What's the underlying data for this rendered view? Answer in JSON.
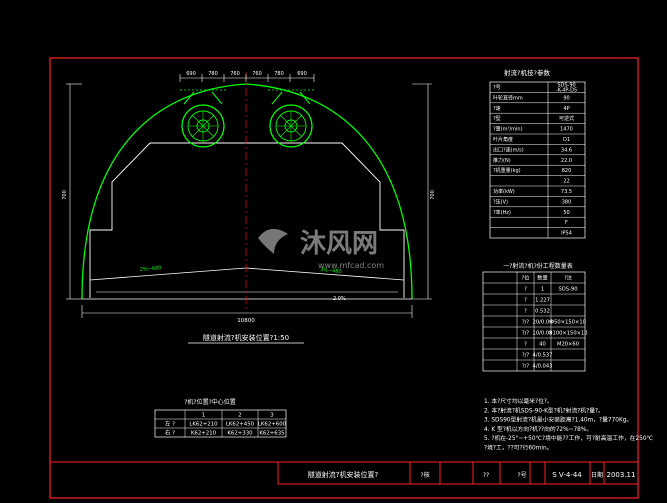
{
  "colors": {
    "frame": "#ff2020",
    "lining": "#00ff00",
    "dims": "#ffffff",
    "text": "#ffffff",
    "fan": "#00ff00",
    "center": "#ff0000",
    "table": "#ffffff"
  },
  "drawing": {
    "top_dims": [
      "690",
      "780",
      "760",
      "760",
      "780",
      "690"
    ],
    "left_dim": "700",
    "right_dim": "700",
    "bottom_dim": "10800",
    "slope_left": "2%~680",
    "slope_right": "3%~680",
    "slope_bottom": "2.0%",
    "caption": "隧道射流?机安装位置?1:50"
  },
  "fan_params": {
    "title": "射流?机技?参数",
    "rows": [
      [
        "?号",
        "SDS-90\n-K-4P-D5"
      ],
      [
        "叶轮直径mm",
        "90"
      ],
      [
        "?速",
        "4P"
      ],
      [
        "?型",
        "可逆式"
      ],
      [
        "?量(m³/min)",
        "1470"
      ],
      [
        "叶片角度",
        "D1"
      ],
      [
        "出口?速(m/s)",
        "34.6"
      ],
      [
        "推力(N)",
        "22.0"
      ],
      [
        "?机重量(kg)",
        "820"
      ],
      [
        "",
        "22"
      ],
      [
        "功率(kW)",
        "73.5"
      ],
      [
        "?压(V)",
        "380"
      ],
      [
        "?率(Hz)",
        "50"
      ],
      [
        "",
        "F"
      ],
      [
        "",
        "IP54"
      ]
    ]
  },
  "install_qty": {
    "title": "一?射流?机?份工程数量表",
    "header": [
      "",
      "?位",
      "数量",
      "?注"
    ],
    "rows": [
      [
        "",
        "?",
        "1",
        "SDS-90"
      ],
      [
        "",
        "?",
        "1.227",
        ""
      ],
      [
        "",
        "?",
        "0.532",
        ""
      ],
      [
        "",
        "?/?",
        "20/0.06",
        "Φ50×150×10"
      ],
      [
        "",
        "?/?",
        "10/0.03",
        "Φ100×150×10"
      ],
      [
        "",
        "?",
        "40",
        "M20×60"
      ],
      [
        "",
        "?/?",
        "4/0.537",
        ""
      ],
      [
        "",
        "?/?",
        "4/0.043",
        ""
      ]
    ]
  },
  "notes": [
    "1. 本?尺寸均以毫米?位?。",
    "2. 本?射流?机SDS-90-K型?机?射流?机?量?。",
    "3. SDS90型射流?机最小安装距离?1.40m，?量770Kg。",
    "4. K 型?机以方向?机??向的72%~78%。",
    "5. ?机在-25°~+50℃?境中能??工作，可?耐高温工作，在250℃",
    "    ?境?工，??可?行60min。"
  ],
  "center_table": {
    "title": "?机?位置?中心位置",
    "header": [
      "",
      "1",
      "2",
      "3"
    ],
    "rows": [
      [
        "左 ?",
        "LK62+210",
        "LK62+450",
        "LK62+600"
      ],
      [
        "右 ?",
        "K62+210",
        "K62+330",
        "K62+635"
      ]
    ]
  },
  "title_block": {
    "name": "隧道射流?机安装位置?",
    "c1": "?核",
    "c2": "??",
    "c3": "?号",
    "sheet": "S V-4-44",
    "date_label": "日期",
    "date": "2003.11"
  },
  "watermark": {
    "brand": "沐风网",
    "url": "www.mfcad.com"
  }
}
